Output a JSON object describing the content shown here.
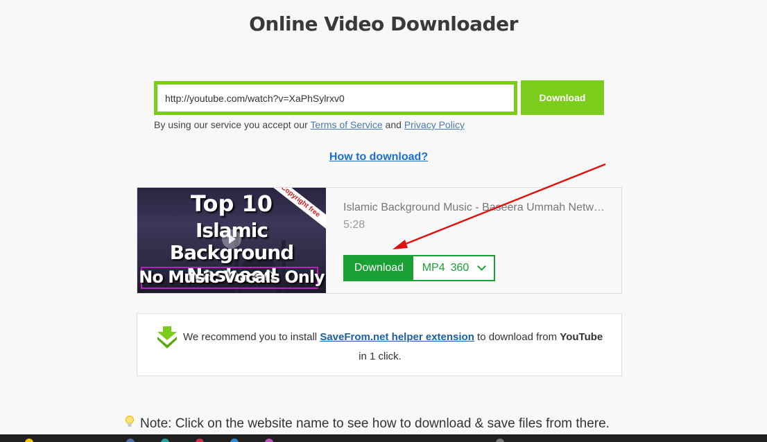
{
  "header": {
    "title": "Online Video Downloader"
  },
  "search": {
    "url_value": "http://youtube.com/watch?v=XaPhSylrxv0",
    "download_label": "Download"
  },
  "terms": {
    "prefix": "By using our service you accept our ",
    "tos_label": "Terms of Service",
    "and": " and ",
    "privacy_label": "Privacy Policy"
  },
  "howto": {
    "label": "How to download?"
  },
  "result": {
    "thumbnail": {
      "line1": "Top 10",
      "line2a": "Islamic Background",
      "line2b": "Nasheed",
      "line3": "No Music Vocals Only",
      "ribbon": "Copyright free"
    },
    "title": "Islamic Background Music - Baseera Ummah Network",
    "duration": "5:28",
    "download_label": "Download",
    "format_type": "MP4",
    "format_quality": "360"
  },
  "recommend": {
    "prefix": "We recommend you to install ",
    "link_label": "SaveFrom.net helper extension",
    "middle": " to download from ",
    "platform": "YouTube",
    "line2": "in 1 click."
  },
  "note": {
    "text": "Note: Click on the website name to see how to download & save files from there."
  },
  "colors": {
    "accent": "#7ccc1b",
    "download_green": "#1aa034",
    "link_blue": "#1a6fd4",
    "arrow_red": "#e01010"
  }
}
